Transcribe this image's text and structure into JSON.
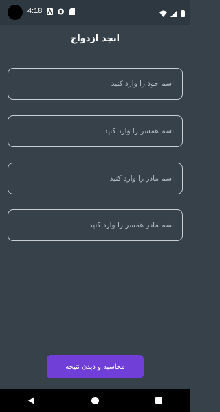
{
  "status": {
    "time": "4:18",
    "icons": [
      "notification-a-icon",
      "notification-b-icon",
      "notification-c-icon",
      "wifi-icon",
      "signal-icon",
      "battery-icon"
    ]
  },
  "header": {
    "title": "ابجد ازدواج"
  },
  "form": {
    "fields": [
      {
        "placeholder": "اسم خود را وارد کنید",
        "value": ""
      },
      {
        "placeholder": "اسم همسر را وارد کنید",
        "value": ""
      },
      {
        "placeholder": "اسم مادر را وارد کنید",
        "value": ""
      },
      {
        "placeholder": "اسم مادر همسر را وارد کنید",
        "value": ""
      }
    ],
    "submit_label": "محاسبه و دیدن نتیجه"
  },
  "nav": {
    "icons": [
      "back-icon",
      "home-icon",
      "recents-icon"
    ]
  },
  "colors": {
    "background": "#36414a",
    "accent": "#6f3fd8",
    "border": "#c9ced3"
  }
}
